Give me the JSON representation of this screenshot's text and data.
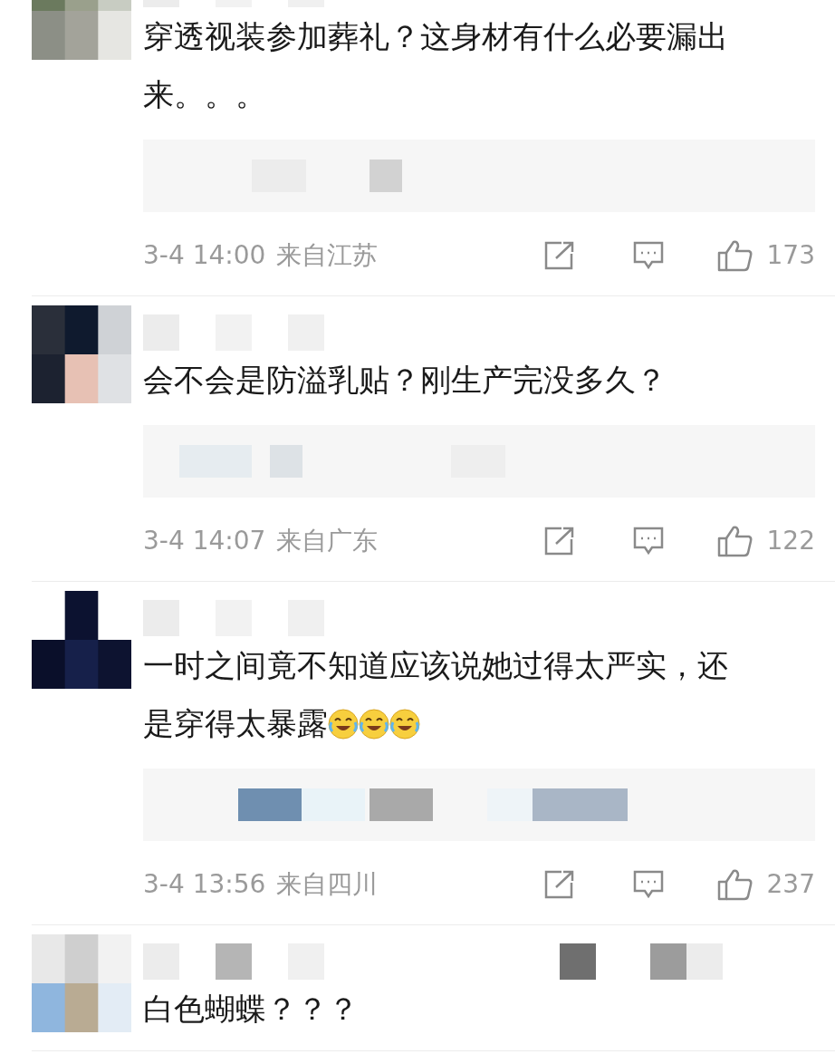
{
  "comments": [
    {
      "lines": [
        "穿透视装参加葬礼？这身材有什么必要漏出",
        "来。。。"
      ],
      "time": "3-4 14:00",
      "location": "来自江苏",
      "likes": "173"
    },
    {
      "lines": [
        "会不会是防溢乳贴？刚生产完没多久？"
      ],
      "time": "3-4 14:07",
      "location": "来自广东",
      "likes": "122"
    },
    {
      "lines": [
        "一时之间竟不知道应该说她过得太严实，还",
        "是穿得太暴露"
      ],
      "emojis": [
        {
          "kind": "laugh-cry"
        },
        {
          "kind": "laugh-cry"
        },
        {
          "kind": "laugh-cry"
        }
      ],
      "time": "3-4 13:56",
      "location": "来自四川",
      "likes": "237"
    },
    {
      "lines": [
        "白色蝴蝶？？？"
      ]
    }
  ]
}
